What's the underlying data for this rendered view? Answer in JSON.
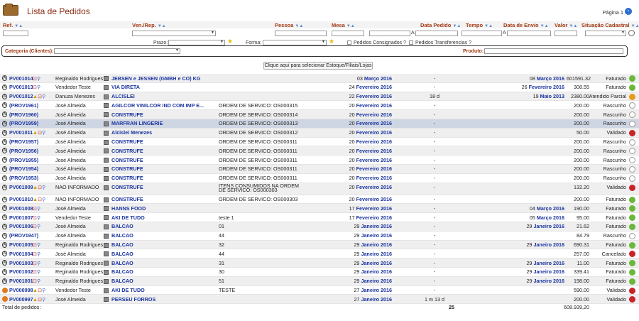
{
  "header": {
    "title": "Lista de Pedidos",
    "page": "Página 1"
  },
  "columns": {
    "ref": "Ref.",
    "ven": "Ven./Rep.",
    "pessoa": "Pessoa",
    "mesa": "Mesa",
    "data": "Data Pedido",
    "tempo": "Tempo",
    "envio": "Data de Envio",
    "valor": "Valor",
    "situacao": "Situação Cadastral"
  },
  "filters": {
    "prazo": "Prazo:",
    "forma": "Forma:",
    "consig": "Pedidos Consignados ?",
    "transf": "Pedidos Transferencias ?",
    "categoria": "Categoria (Clientes):",
    "produto": "Produto:",
    "a1": "A",
    "a2": "A",
    "select_button": "Clique aqui para selecionar Estoque/Filiais/Lojas"
  },
  "rows": [
    {
      "ref": "PV001014",
      "ven": "Reginaldo Rodrigues",
      "pes": "JEBSEN e JESSEN (GMBH e CO) KG",
      "mesa": "",
      "d": "03",
      "m": "Março 2016",
      "tempo": "-",
      "ed": "08",
      "em": "Março 2016",
      "val": "601591.32",
      "sit": "Faturado",
      "c": "g"
    },
    {
      "ref": "PV001013",
      "ven": "Vendedor Teste",
      "pes": "VIA DIRETA",
      "mesa": "",
      "d": "24",
      "m": "Fevereiro 2016",
      "tempo": "-",
      "ed": "26",
      "em": "Fevereiro 2016",
      "val": "308.55",
      "sit": "Faturado",
      "c": "g"
    },
    {
      "ref": "PV001012",
      "ven": "Danuza Menezes",
      "pes": "ALCISLEI",
      "mesa": "",
      "d": "22",
      "m": "Fevereiro 2016",
      "tempo": "18 d",
      "ed": "19",
      "em": "Maio 2013",
      "val": "2380.00",
      "sit": "Atendido Parcial",
      "c": "o"
    },
    {
      "ref": "(PROV1961)",
      "ven": "José Almeida",
      "pes": "AGILCOR VINILCOR IND COM IMP E...",
      "mesa": "ORDEM DE SERVICO: OS000315",
      "d": "20",
      "m": "Fevereiro 2016",
      "tempo": "-",
      "ed": "",
      "em": "",
      "val": "200.00",
      "sit": "Rascunho",
      "c": "w"
    },
    {
      "ref": "(PROV1960)",
      "ven": "José Almeida",
      "pes": "CONSTRUFE",
      "mesa": "ORDEM DE SERVICO: OS000314",
      "d": "20",
      "m": "Fevereiro 2016",
      "tempo": "-",
      "ed": "",
      "em": "",
      "val": "200.00",
      "sit": "Rascunho",
      "c": "w"
    },
    {
      "ref": "(PROV1959)",
      "ven": "José Almeida",
      "pes": "MARFRAN LINGERIE",
      "mesa": "ORDEM DE SERVICO: OS000313",
      "d": "20",
      "m": "Fevereiro 2016",
      "tempo": "-",
      "ed": "",
      "em": "",
      "val": "200.00",
      "sit": "Rascunho",
      "c": "w"
    },
    {
      "ref": "PV001011",
      "ven": "José Almeida",
      "pes": "Alcislei Menezes",
      "mesa": "ORDEM DE SERVICO: OS000312",
      "d": "20",
      "m": "Fevereiro 2016",
      "tempo": "-",
      "ed": "",
      "em": "",
      "val": "50.00",
      "sit": "Validado",
      "c": "r"
    },
    {
      "ref": "(PROV1957)",
      "ven": "José Almeida",
      "pes": "CONSTRUFE",
      "mesa": "ORDEM DE SERVICO: OS000311",
      "d": "20",
      "m": "Fevereiro 2016",
      "tempo": "-",
      "ed": "",
      "em": "",
      "val": "200.00",
      "sit": "Rascunho",
      "c": "w"
    },
    {
      "ref": "(PROV1956)",
      "ven": "José Almeida",
      "pes": "CONSTRUFE",
      "mesa": "ORDEM DE SERVICO: OS000311",
      "d": "20",
      "m": "Fevereiro 2016",
      "tempo": "-",
      "ed": "",
      "em": "",
      "val": "200.00",
      "sit": "Rascunho",
      "c": "w"
    },
    {
      "ref": "(PROV1955)",
      "ven": "José Almeida",
      "pes": "CONSTRUFE",
      "mesa": "ORDEM DE SERVICO: OS000311",
      "d": "20",
      "m": "Fevereiro 2016",
      "tempo": "-",
      "ed": "",
      "em": "",
      "val": "200.00",
      "sit": "Rascunho",
      "c": "w"
    },
    {
      "ref": "(PROV1954)",
      "ven": "José Almeida",
      "pes": "CONSTRUFE",
      "mesa": "ORDEM DE SERVICO: OS000311",
      "d": "20",
      "m": "Fevereiro 2016",
      "tempo": "-",
      "ed": "",
      "em": "",
      "val": "200.00",
      "sit": "Rascunho",
      "c": "w"
    },
    {
      "ref": "(PROV1953)",
      "ven": "José Almeida",
      "pes": "CONSTRUFE",
      "mesa": "ORDEM DE SERVICO: OS000311",
      "d": "20",
      "m": "Fevereiro 2016",
      "tempo": "-",
      "ed": "",
      "em": "",
      "val": "200.00",
      "sit": "Rascunho",
      "c": "w"
    },
    {
      "ref": "PV001009",
      "ven": "NAO INFORMADO",
      "pes": "CONSTRUFE",
      "mesa": "ITENS CONSUMIDOS NA ORDEM",
      "mesa2": "DE SERVICO: OS000303",
      "d": "20",
      "m": "Fevereiro 2016",
      "tempo": "-",
      "ed": "",
      "em": "",
      "val": "132.20",
      "sit": "Validado",
      "c": "r"
    },
    {
      "ref": "PV001010",
      "ven": "NAO INFORMADO",
      "pes": "CONSTRUFE",
      "mesa": "ORDEM DE SERVICO: OS000303",
      "d": "20",
      "m": "Fevereiro 2016",
      "tempo": "-",
      "ed": "",
      "em": "",
      "val": "200.00",
      "sit": "Faturado",
      "c": "g"
    },
    {
      "ref": "PV001008",
      "ven": "José Almeida",
      "pes": "HANNS FOOD",
      "mesa": "",
      "d": "17",
      "m": "Fevereiro 2016",
      "tempo": "-",
      "ed": "04",
      "em": "Março 2016",
      "val": "190.00",
      "sit": "Faturado",
      "c": "g"
    },
    {
      "ref": "PV001007",
      "ven": "Vendedor Teste",
      "pes": "AKI DE TUDO",
      "mesa": "teste 1",
      "d": "17",
      "m": "Fevereiro 2016",
      "tempo": "-",
      "ed": "05",
      "em": "Março 2016",
      "val": "95.00",
      "sit": "Faturado",
      "c": "g"
    },
    {
      "ref": "PV001006",
      "ven": "José Almeida",
      "pes": "BALCAO",
      "mesa": "01",
      "d": "29",
      "m": "Janeiro 2016",
      "tempo": "-",
      "ed": "29",
      "em": "Janeiro 2016",
      "val": "21.62",
      "sit": "Faturado",
      "c": "g"
    },
    {
      "ref": "(PROV1947)",
      "ven": "José Almeida",
      "pes": "BALCAO",
      "mesa": "44",
      "d": "29",
      "m": "Janeiro 2016",
      "tempo": "-",
      "ed": "",
      "em": "",
      "val": "84.79",
      "sit": "Rascunho",
      "c": "w"
    },
    {
      "ref": "PV001005",
      "ven": "Reginaldo Rodrigues",
      "pes": "BALCAO",
      "mesa": "32",
      "d": "29",
      "m": "Janeiro 2016",
      "tempo": "-",
      "ed": "29",
      "em": "Janeiro 2016",
      "val": "690.31",
      "sit": "Faturado",
      "c": "g"
    },
    {
      "ref": "PV001004",
      "ven": "José Almeida",
      "pes": "BALCAO",
      "mesa": "44",
      "d": "29",
      "m": "Janeiro 2016",
      "tempo": "-",
      "ed": "",
      "em": "",
      "val": "257.00",
      "sit": "Cancelado",
      "c": "r"
    },
    {
      "ref": "PV001003",
      "ven": "Reginaldo Rodrigues",
      "pes": "BALCAO",
      "mesa": "31",
      "d": "29",
      "m": "Janeiro 2016",
      "tempo": "-",
      "ed": "29",
      "em": "Janeiro 2016",
      "val": "11.00",
      "sit": "Faturado",
      "c": "g"
    },
    {
      "ref": "PV001002",
      "ven": "Reginaldo Rodrigues",
      "pes": "BALCAO",
      "mesa": "30",
      "d": "29",
      "m": "Janeiro 2016",
      "tempo": "-",
      "ed": "29",
      "em": "Janeiro 2016",
      "val": "339.41",
      "sit": "Faturado",
      "c": "g"
    },
    {
      "ref": "PV001001",
      "ven": "Reginaldo Rodrigues",
      "pes": "BALCAO",
      "mesa": "51",
      "d": "29",
      "m": "Janeiro 2016",
      "tempo": "-",
      "ed": "29",
      "em": "Janeiro 2016",
      "val": "198.00",
      "sit": "Faturado",
      "c": "g"
    },
    {
      "ref": "PV000998",
      "ven": "Vendedor Teste",
      "pes": "AKI DE TUDO",
      "mesa": "TESTE",
      "d": "27",
      "m": "Janeiro 2016",
      "tempo": "-",
      "ed": "",
      "em": "",
      "val": "590.00",
      "sit": "Validado",
      "c": "r"
    },
    {
      "ref": "PV000997",
      "ven": "José Almeida",
      "pes": "PERSEU FORROS",
      "mesa": "",
      "d": "27",
      "m": "Janeiro 2016",
      "tempo": "1 m 13 d",
      "ed": "",
      "em": "",
      "val": "200.00",
      "sit": "Validado",
      "c": "r"
    }
  ],
  "totals": {
    "label": "Total de pedidos:",
    "count": "25",
    "value": "608.939,20"
  }
}
